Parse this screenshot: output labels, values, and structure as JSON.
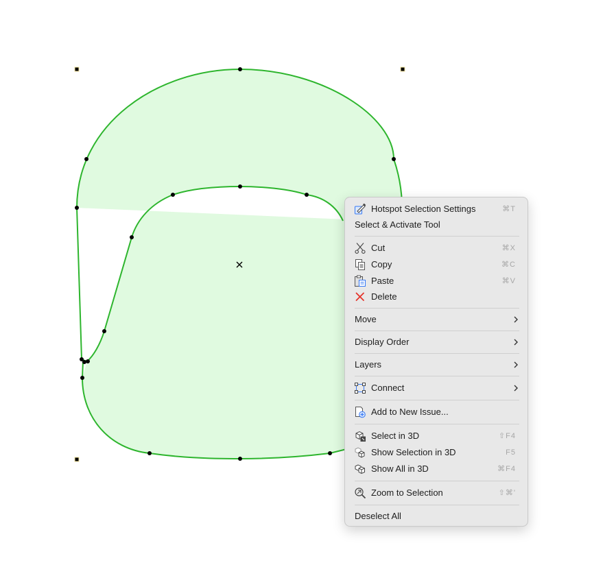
{
  "context_menu": {
    "items": [
      {
        "label": "Hotspot Selection Settings",
        "shortcut": "⌘T",
        "icon": "hotspot-settings-icon"
      },
      {
        "label": "Select & Activate Tool",
        "shortcut": "",
        "icon": ""
      },
      {
        "label": "Cut",
        "shortcut": "⌘X",
        "icon": "scissors-icon"
      },
      {
        "label": "Copy",
        "shortcut": "⌘C",
        "icon": "copy-icon"
      },
      {
        "label": "Paste",
        "shortcut": "⌘V",
        "icon": "clipboard-icon"
      },
      {
        "label": "Delete",
        "shortcut": "",
        "icon": "delete-x-icon",
        "icon_color": "#e5332a"
      },
      {
        "label": "Move",
        "submenu": true
      },
      {
        "label": "Display Order",
        "submenu": true
      },
      {
        "label": "Layers",
        "submenu": true
      },
      {
        "label": "Connect",
        "submenu": true,
        "icon": "connect-icon"
      },
      {
        "label": "Add to New Issue...",
        "icon": "add-issue-icon"
      },
      {
        "label": "Select in 3D",
        "shortcut": "⇧F4",
        "icon": "select-3d-icon"
      },
      {
        "label": "Show Selection in 3D",
        "shortcut": "F5",
        "icon": "show-selection-3d-icon"
      },
      {
        "label": "Show All in 3D",
        "shortcut": "⌘F4",
        "icon": "show-all-3d-icon"
      },
      {
        "label": "Zoom to Selection",
        "shortcut": "⇧⌘'",
        "icon": "zoom-selection-icon"
      },
      {
        "label": "Deselect All"
      }
    ]
  },
  "colors": {
    "shape_fill": "#e0fae0",
    "shape_stroke": "#2db52d",
    "menu_background": "#e8e8e8",
    "delete_icon": "#e5332a",
    "accent_icon": "#3478f6"
  }
}
